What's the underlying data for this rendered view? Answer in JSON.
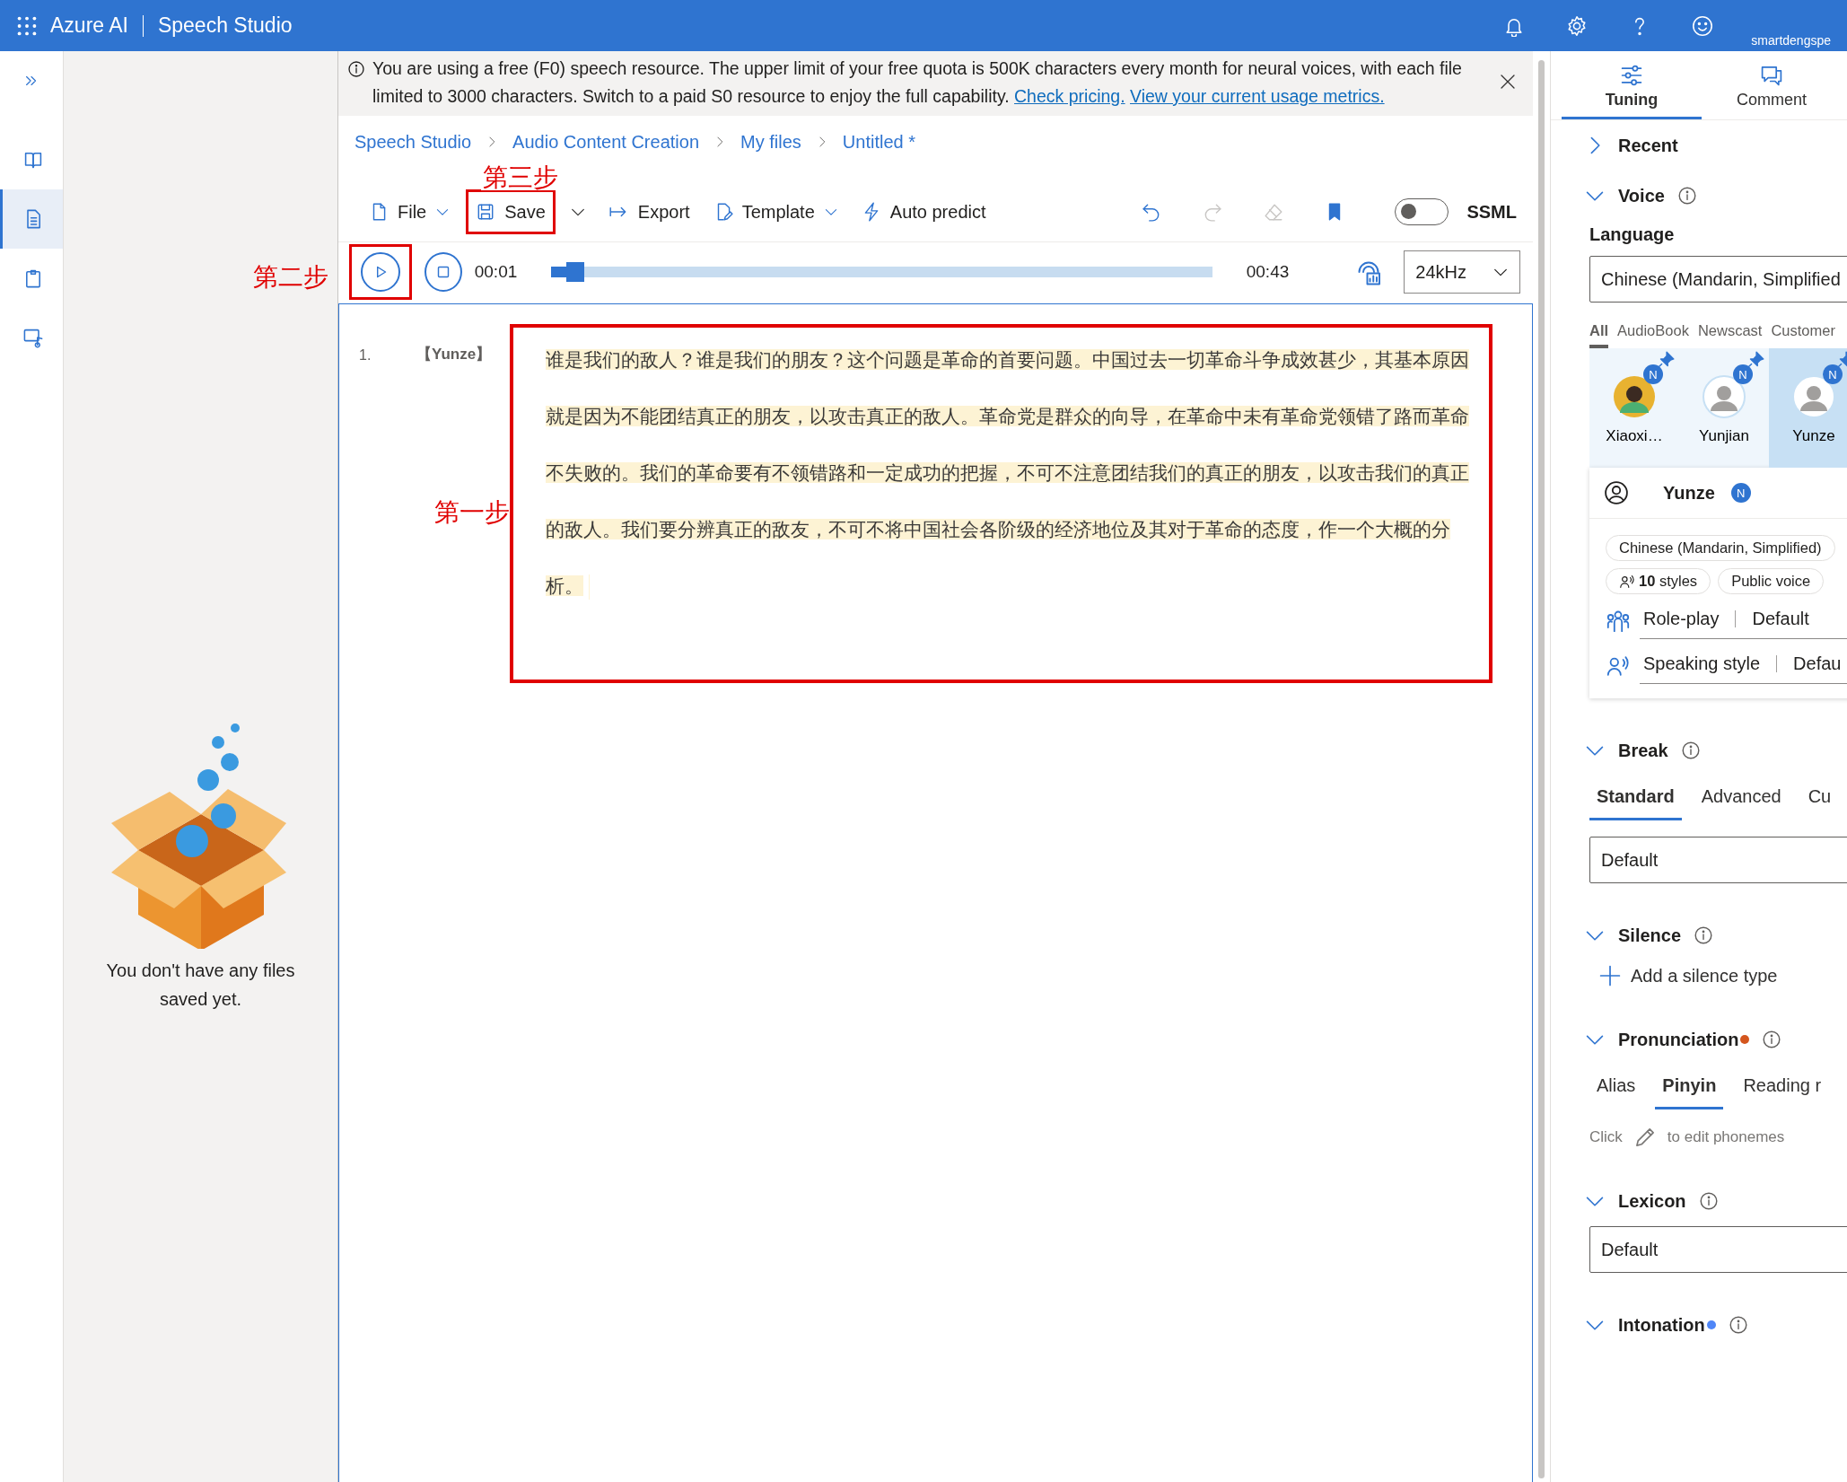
{
  "top_bar": {
    "brand": "Azure AI",
    "product": "Speech Studio",
    "user": "smartdengspe"
  },
  "left_rail": {
    "items": [
      {
        "kind": "book",
        "selected": false
      },
      {
        "kind": "document",
        "selected": true
      },
      {
        "kind": "clipboard",
        "selected": false
      },
      {
        "kind": "media",
        "selected": false
      }
    ]
  },
  "files_panel": {
    "empty_message": "You don't have any files saved yet."
  },
  "banner": {
    "text": "You are using a free (F0) speech resource. The upper limit of your free quota is 500K characters every month for neural voices, with each file limited to 3000 characters. Switch to a paid S0 resource to enjoy the full capability.",
    "links": [
      "Check pricing.",
      "View your current usage metrics."
    ]
  },
  "breadcrumb": [
    "Speech Studio",
    "Audio Content Creation",
    "My files",
    "Untitled *"
  ],
  "toolbar": {
    "buttons": [
      {
        "kind": "file",
        "label": "File",
        "dropdown": true
      },
      {
        "kind": "save",
        "label": "Save",
        "split": true,
        "annotation": "第三步"
      },
      {
        "kind": "export",
        "label": "Export"
      },
      {
        "kind": "template",
        "label": "Template",
        "dropdown": true
      },
      {
        "kind": "auto",
        "label": "Auto predict"
      }
    ],
    "icon_buttons": [
      {
        "kind": "undo",
        "disabled": false
      },
      {
        "kind": "redo",
        "disabled": true
      },
      {
        "kind": "eraser",
        "disabled": true
      },
      {
        "kind": "bookmark",
        "disabled": false
      }
    ],
    "ssml": {
      "label": "SSML",
      "on": false
    }
  },
  "player": {
    "annotation": "第二步",
    "current": "00:01",
    "level": 0.05,
    "total": "00:43",
    "sample_rate": "24kHz"
  },
  "editor": {
    "paragraphs": [
      {
        "number": "1.",
        "voice": "【Yunze】",
        "text": "谁是我们的敌人？谁是我们的朋友？这个问题是革命的首要问题。中国过去一切革命斗争成效甚少，其基本原因就是因为不能团结真正的朋友，以攻击真正的敌人。革命党是群众的向导，在革命中未有革命党领错了路而革命不失败的。我们的革命要有不领错路和一定成功的把握，不可不注意团结我们的真正的朋友，以攻击我们的真正的敌人。我们要分辨真正的敌友，不可不将中国社会各阶级的经济地位及其对于革命的态度，作一个大概的分析。",
        "annotation": "第一步"
      }
    ]
  },
  "right_panel": {
    "tabs": [
      {
        "kind": "tuning",
        "label": "Tuning",
        "selected": true
      },
      {
        "kind": "comment",
        "label": "Comment",
        "selected": false
      }
    ],
    "sections": [
      {
        "kind": "plain",
        "title": "Recent",
        "expanded": false
      },
      {
        "kind": "voice",
        "title": "Voice",
        "expanded": true,
        "info": true,
        "language_label": "Language",
        "language_value": "Chinese (Mandarin, Simplified",
        "categories": [
          {
            "label": "All",
            "selected": true
          },
          {
            "label": "AudioBook",
            "selected": false
          },
          {
            "label": "Newscast",
            "selected": false
          },
          {
            "label": "Customer",
            "selected": false
          }
        ],
        "voices": [
          {
            "name": "Xiaoxi…",
            "kind": "female",
            "badge": "N",
            "selected": false
          },
          {
            "name": "Yunjian",
            "kind": "male",
            "badge": "N",
            "selected": false
          },
          {
            "name": "Yunze",
            "kind": "male",
            "badge": "N",
            "selected": true
          }
        ],
        "card": {
          "name": "Yunze",
          "badge": "N",
          "chips": [
            {
              "kind": "plain",
              "text": "Chinese (Mandarin, Simplified)"
            },
            {
              "kind": "styles",
              "text": "**10** styles"
            },
            {
              "kind": "plain",
              "text": "Public voice"
            }
          ],
          "rows": [
            {
              "kind": "role",
              "label": "Role-play",
              "value": "Default"
            },
            {
              "kind": "style",
              "label": "Speaking style",
              "value": "Defau"
            }
          ]
        }
      },
      {
        "kind": "tabs_select",
        "title": "Break",
        "expanded": true,
        "info": true,
        "tabs": [
          {
            "label": "Standard",
            "selected": true
          },
          {
            "label": "Advanced",
            "selected": false
          },
          {
            "label": "Cu",
            "selected": false
          }
        ],
        "value": "Default"
      },
      {
        "kind": "add",
        "title": "Silence",
        "expanded": true,
        "info": true,
        "action": "Add a silence type"
      },
      {
        "kind": "hint_tabs",
        "title": "Pronunciation",
        "expanded": true,
        "info": true,
        "color": "#d4561e",
        "tabs": [
          {
            "label": "Alias",
            "selected": false
          },
          {
            "label": "Pinyin",
            "selected": true
          },
          {
            "label": "Reading r",
            "selected": false
          }
        ],
        "hint_before": "Click",
        "hint_after": "to edit phonemes"
      },
      {
        "kind": "select",
        "title": "Lexicon",
        "expanded": true,
        "info": true,
        "value": "Default"
      },
      {
        "kind": "plain",
        "title": "Intonation",
        "expanded": true,
        "info": true,
        "color": "#4f86f7"
      }
    ]
  }
}
